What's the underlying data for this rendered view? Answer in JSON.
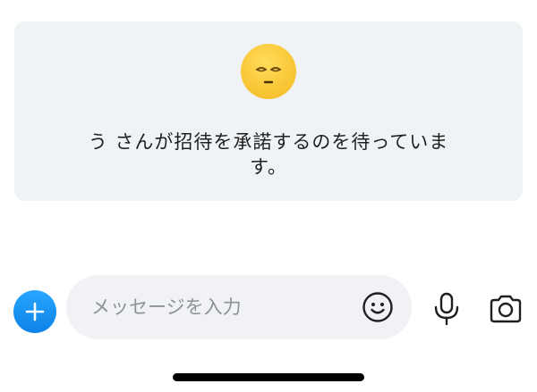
{
  "invite_card": {
    "avatar_emoji": "eyes-closed-face-emoji",
    "status_message": "う さんが招待を承諾するのを待っています。"
  },
  "composer": {
    "message_placeholder": "メッセージを入力",
    "add_icon": "plus-icon",
    "emoji_icon": "smiley-icon",
    "mic_icon": "microphone-icon",
    "camera_icon": "camera-icon",
    "accent_color": "#1a95f5"
  }
}
